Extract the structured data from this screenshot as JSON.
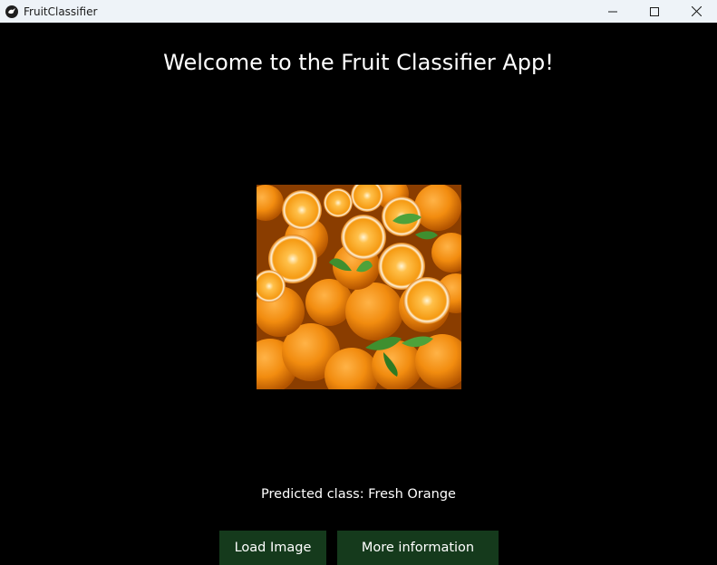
{
  "window": {
    "title": "FruitClassifier",
    "app_icon": "kivy-logo-icon",
    "controls": [
      "minimize-icon",
      "maximize-icon",
      "close-icon"
    ]
  },
  "main": {
    "heading": "Welcome to the Fruit Classifier App!",
    "image": {
      "subject": "oranges-photo"
    },
    "prediction_text": "Predicted class: Fresh Orange"
  },
  "buttons": {
    "load_image_label": "Load Image",
    "more_info_label": "More information"
  },
  "colors": {
    "background": "#000000",
    "button_bg": "#153a1c",
    "text": "#ffffff",
    "titlebar_bg": "#eef3f8"
  }
}
